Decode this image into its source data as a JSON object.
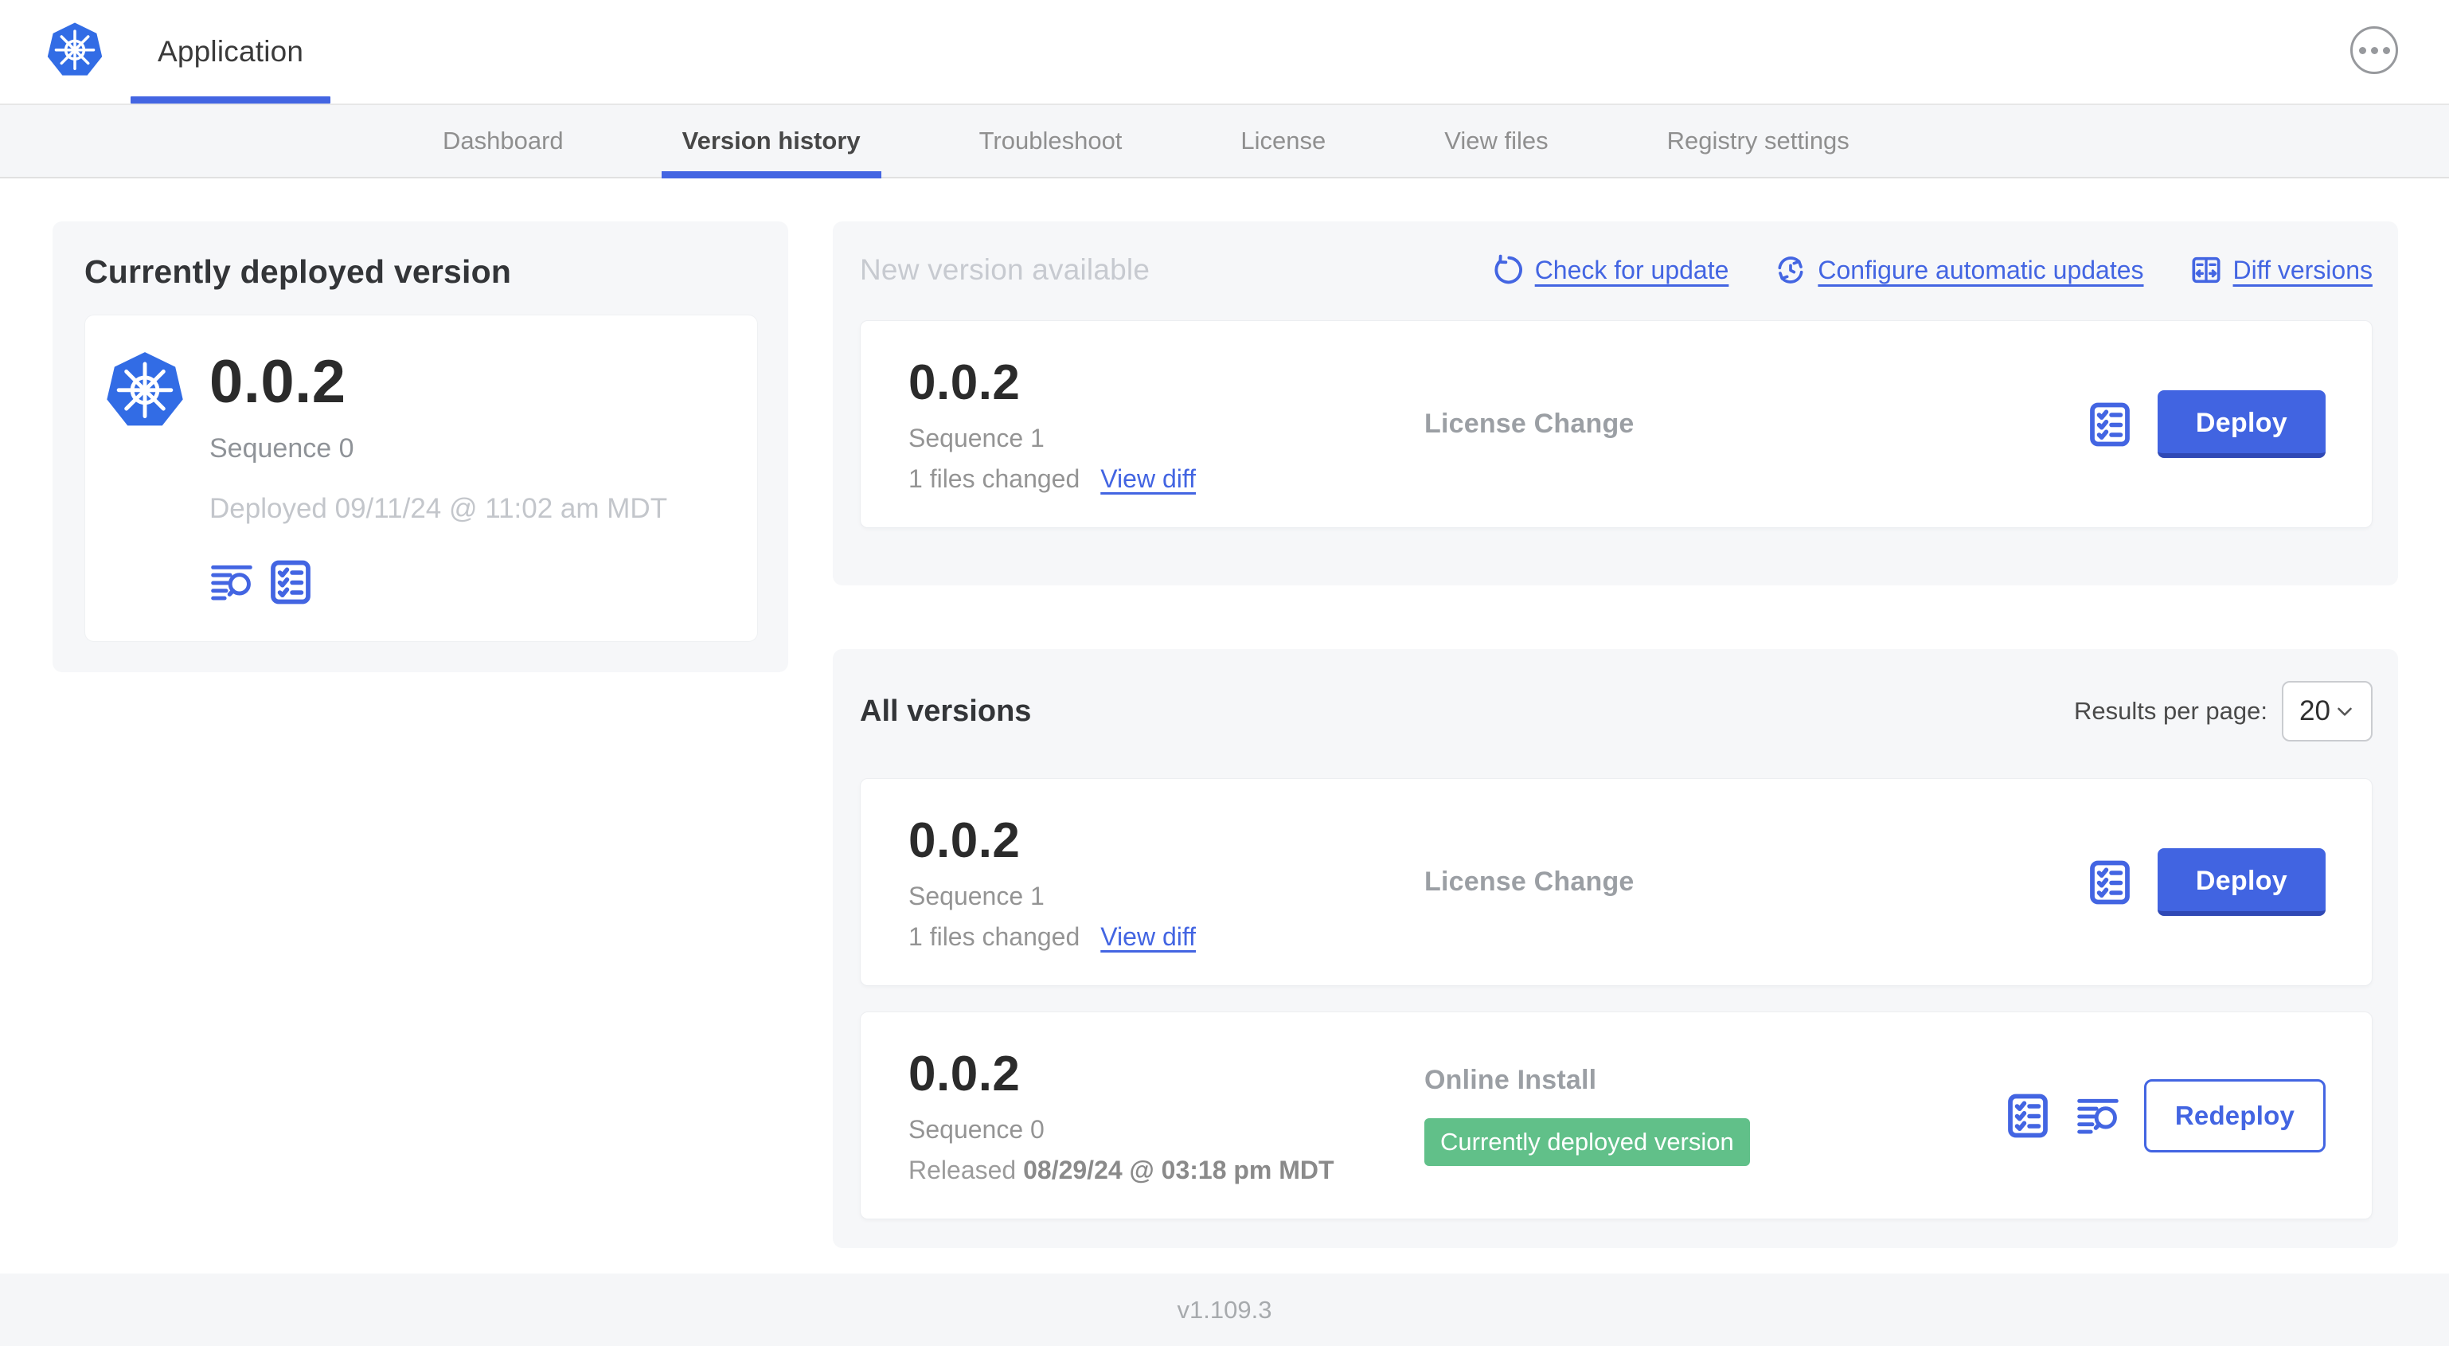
{
  "header": {
    "app_title": "Application"
  },
  "nav": {
    "tabs": [
      "Dashboard",
      "Version history",
      "Troubleshoot",
      "License",
      "View files",
      "Registry settings"
    ],
    "active_tab": "Version history"
  },
  "current": {
    "title": "Currently deployed version",
    "version": "0.0.2",
    "sequence": "Sequence 0",
    "deployed": "Deployed 09/11/24 @ 11:02 am MDT"
  },
  "new_version": {
    "title": "New version available",
    "check_for_update": "Check for update",
    "configure_updates": "Configure automatic updates",
    "diff_versions": "Diff versions",
    "version": "0.0.2",
    "sequence": "Sequence 1",
    "files_changed": "1 files changed",
    "view_diff": "View diff",
    "source": "License Change",
    "deploy": "Deploy"
  },
  "all_versions": {
    "title": "All versions",
    "results_label": "Results per page:",
    "results_value": "20",
    "rows": [
      {
        "version": "0.0.2",
        "sequence": "Sequence 1",
        "files_changed": "1 files changed",
        "view_diff": "View diff",
        "source": "License Change",
        "action": "Deploy"
      },
      {
        "version": "0.0.2",
        "sequence": "Sequence 0",
        "released_label": "Released",
        "released_date": "08/29/24 @ 03:18 pm MDT",
        "source": "Online Install",
        "badge": "Currently deployed version",
        "action": "Redeploy"
      }
    ]
  },
  "footer": {
    "app_version": "v1.109.3"
  },
  "colors": {
    "accent_blue": "#4365E2",
    "k8s_logo_blue": "#326CE5",
    "badge_green": "#61C089",
    "panel_gray": "#F6F7F9"
  }
}
